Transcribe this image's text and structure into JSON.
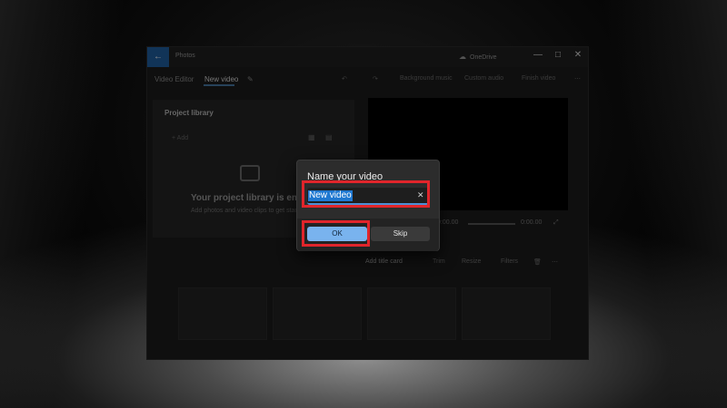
{
  "window": {
    "app_title": "Photos",
    "back_glyph": "←",
    "onedrive_label": "OneDrive",
    "onedrive_glyph": "☁",
    "minimize_glyph": "—",
    "maximize_glyph": "□",
    "close_glyph": "✕"
  },
  "tabs": {
    "video_editor": "Video Editor",
    "new_video": "New video",
    "edit_glyph": "✎"
  },
  "toolbar": {
    "undo_glyph": "↶",
    "redo_glyph": "↷",
    "background_music": "Background music",
    "custom_audio": "Custom audio",
    "finish_video": "Finish video",
    "more_glyph": "⋯"
  },
  "library": {
    "title": "Project library",
    "add_label": "Add",
    "empty_title": "Your project library is empty",
    "empty_subtitle": "Add photos and video clips to get started"
  },
  "player": {
    "current_time": "0:00.00",
    "total_time": "0:00.00"
  },
  "timeline": {
    "add_title_card": "Add title card",
    "trim": "Trim",
    "resize": "Resize",
    "filters": "Filters",
    "more_glyph": "⋯"
  },
  "dialog": {
    "title": "Name your video",
    "input_value": "New video",
    "clear_glyph": "✕",
    "ok_label": "OK",
    "skip_label": "Skip"
  },
  "colors": {
    "highlight": "#e0252b",
    "accent": "#79b3ee",
    "selection": "#1f78d1"
  }
}
